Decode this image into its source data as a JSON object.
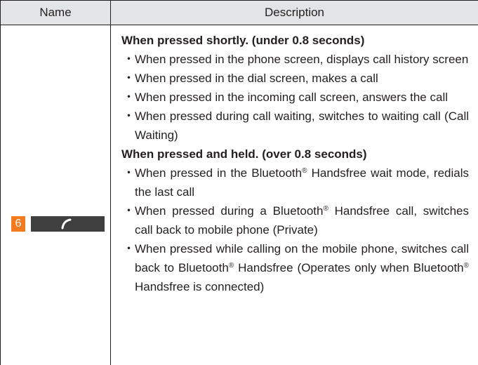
{
  "table": {
    "header": {
      "name": "Name",
      "description": "Description"
    },
    "row": {
      "badge": "6",
      "bullet": "・",
      "registered_mark": "®",
      "sections": [
        {
          "heading": "When pressed shortly. (under 0.8 seconds)",
          "items": [
            {
              "text": "When pressed in the phone screen, displays call history screen"
            },
            {
              "text": "When pressed in the dial screen, makes a call"
            },
            {
              "text": "When pressed in the incoming call screen, answers the call"
            },
            {
              "text": "When pressed during call waiting, switches to waiting call (Call Waiting)"
            }
          ]
        },
        {
          "heading": "When pressed and held. (over 0.8 seconds)",
          "items": [
            {
              "t1": "When pressed in the Bluetooth",
              "t2": " Handsfree wait mode, redials the last call"
            },
            {
              "t1": "When pressed during a Bluetooth",
              "t2": " Handsfree call, switches call back to mobile phone (Private)"
            },
            {
              "t1": "When pressed while calling on the mobile phone, switches call back to Bluetooth",
              "t2": " Handsfree (Operates only when Bluetooth",
              "t3": " Handsfree is connected)"
            }
          ]
        }
      ]
    }
  },
  "colors": {
    "badge": "#f47a20",
    "button": "#3f3f40",
    "header_bg": "#e3e4e5"
  }
}
